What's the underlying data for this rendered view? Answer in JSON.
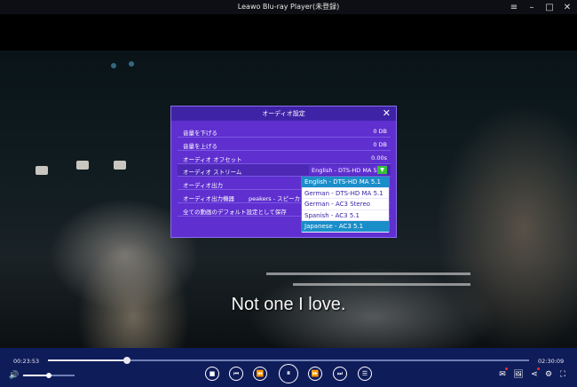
{
  "window": {
    "title": "Leawo Blu-ray Player(未登録)",
    "buttons": [
      {
        "name": "menu",
        "icon": "hamburger-menu-icon",
        "glyph": "≡"
      },
      {
        "name": "minimize",
        "icon": "minimize-icon",
        "glyph": "–"
      },
      {
        "name": "maximize",
        "icon": "maximize-icon",
        "glyph": "□"
      },
      {
        "name": "close",
        "icon": "close-icon",
        "glyph": "✕"
      }
    ]
  },
  "video": {
    "subtitle": "Not one I love."
  },
  "dialog": {
    "title": "オーディオ設定",
    "close_glyph": "✕",
    "rows": {
      "volume_down": {
        "label": "音量を下げる",
        "value": "0 DB"
      },
      "volume_up": {
        "label": "音量を上げる",
        "value": "0 DB"
      },
      "offset": {
        "label": "オーディオ オフセット",
        "value": "0.00s"
      },
      "stream": {
        "label": "オーディオ ストリーム",
        "value": "English - DTS-HD MA 5.1"
      },
      "output": {
        "label": "オーディオ出力",
        "value": ""
      },
      "device": {
        "label": "オーディオ出力機器",
        "value": "peakers - スピーカー (I"
      },
      "save_default": {
        "label": "全ての動画のデフォルト設定として保存"
      }
    },
    "dropdown_arrow": "▼",
    "stream_options": [
      "English - DTS-HD MA 5.1",
      "German - DTS-HD MA 5.1",
      "German - AC3 Stereo",
      "Spanish - AC3 5.1",
      "Japanese - AC3 5.1"
    ],
    "highlighted_option_index": 0,
    "hovered_option_index": 4
  },
  "controls": {
    "current_time": "00:23:53",
    "total_time": "02:30:09",
    "progress_fraction": 0.164,
    "volume_fraction": 0.5,
    "buttons": {
      "stop": "■",
      "prev": "⏮",
      "rewind": "⏪",
      "pause": "⏸",
      "forward": "⏩",
      "next": "⏭",
      "playlist": "☰"
    },
    "right_icons": {
      "message": "✉",
      "screenshot": "🖼",
      "share": "⋖",
      "settings": "⚙",
      "fullscreen": "⛶"
    },
    "volume_glyph": "🔊"
  },
  "colors": {
    "dialog_bg": "#5f2fd0",
    "dialog_header": "#3f23a6",
    "selected_option": "#1a8ec9",
    "control_bar": "#0f1c5a",
    "dropdown_arrow": "#34c23a"
  }
}
